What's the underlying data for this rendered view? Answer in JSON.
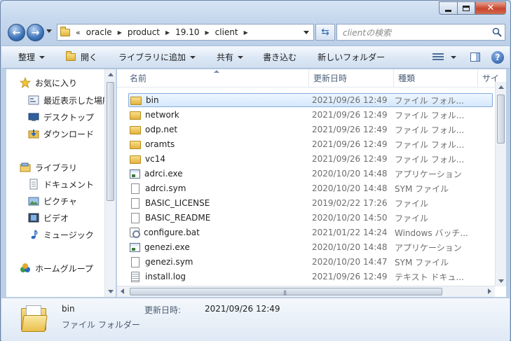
{
  "window": {
    "controls": {
      "minimize": "",
      "maximize": "",
      "close": "✕"
    }
  },
  "address": {
    "overflow": "«",
    "crumbs": [
      "oracle",
      "product",
      "19.10",
      "client"
    ],
    "search_placeholder": "clientの検索"
  },
  "toolbar": {
    "organize": "整理",
    "open": "開く",
    "include_library": "ライブラリに追加",
    "share": "共有",
    "burn": "書き込む",
    "new_folder": "新しいフォルダー",
    "help": "?"
  },
  "nav": {
    "favorites": "お気に入り",
    "recent": "最近表示した場所",
    "desktop": "デスクトップ",
    "downloads": "ダウンロード",
    "libraries": "ライブラリ",
    "documents": "ドキュメント",
    "pictures": "ピクチャ",
    "videos": "ビデオ",
    "music": "ミュージック",
    "homegroup": "ホームグループ"
  },
  "columns": {
    "name": "名前",
    "date": "更新日時",
    "type": "種類",
    "size": "サイ"
  },
  "files": [
    {
      "name": "bin",
      "date": "2021/09/26 12:49",
      "type": "ファイル フォル...",
      "icon": "folder"
    },
    {
      "name": "network",
      "date": "2021/09/26 12:49",
      "type": "ファイル フォル...",
      "icon": "folder"
    },
    {
      "name": "odp.net",
      "date": "2021/09/26 12:49",
      "type": "ファイル フォル...",
      "icon": "folder"
    },
    {
      "name": "oramts",
      "date": "2021/09/26 12:49",
      "type": "ファイル フォル...",
      "icon": "folder"
    },
    {
      "name": "vc14",
      "date": "2021/09/26 12:49",
      "type": "ファイル フォル...",
      "icon": "folder"
    },
    {
      "name": "adrci.exe",
      "date": "2020/10/20 14:48",
      "type": "アプリケーション",
      "icon": "exe"
    },
    {
      "name": "adrci.sym",
      "date": "2020/10/20 14:48",
      "type": "SYM ファイル",
      "icon": "file"
    },
    {
      "name": "BASIC_LICENSE",
      "date": "2019/02/22 17:26",
      "type": "ファイル",
      "icon": "file"
    },
    {
      "name": "BASIC_README",
      "date": "2020/10/20 14:50",
      "type": "ファイル",
      "icon": "file"
    },
    {
      "name": "configure.bat",
      "date": "2021/01/22 14:24",
      "type": "Windows バッチ...",
      "icon": "bat"
    },
    {
      "name": "genezi.exe",
      "date": "2020/10/20 14:48",
      "type": "アプリケーション",
      "icon": "exe"
    },
    {
      "name": "genezi.sym",
      "date": "2020/10/20 14:47",
      "type": "SYM ファイル",
      "icon": "file"
    },
    {
      "name": "install.log",
      "date": "2021/09/26 12:49",
      "type": "テキスト ドキュ...",
      "icon": "log"
    }
  ],
  "details": {
    "name": "bin",
    "type": "ファイル フォルダー",
    "modified_label": "更新日時:",
    "modified_value": "2021/09/26 12:49"
  }
}
